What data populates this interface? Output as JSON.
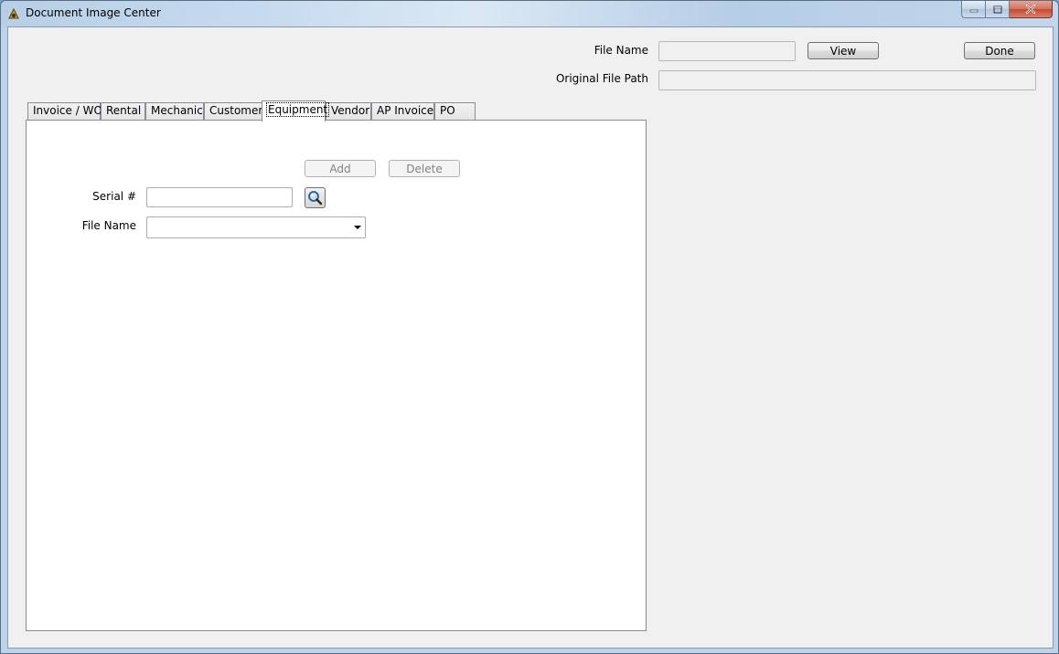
{
  "window": {
    "title": "Document Image Center"
  },
  "header": {
    "file_name_label": "File Name",
    "file_name_value": "",
    "original_path_label": "Original File Path",
    "original_path_value": "",
    "view_label": "View",
    "done_label": "Done"
  },
  "tabs": [
    {
      "label": "Invoice / WO"
    },
    {
      "label": "Rental"
    },
    {
      "label": "Mechanic"
    },
    {
      "label": "Customer"
    },
    {
      "label": "Equipment",
      "active": true
    },
    {
      "label": "Vendor"
    },
    {
      "label": "AP Invoice"
    },
    {
      "label": "PO"
    }
  ],
  "panel": {
    "add_label": "Add",
    "delete_label": "Delete",
    "serial_label": "Serial #",
    "serial_value": "",
    "file_name_label": "File Name",
    "file_name_selected": ""
  },
  "icons": {
    "app": "app-icon",
    "search": "magnifier-search-icon",
    "dropdown": "chevron-down-icon"
  },
  "colors": {
    "client_bg": "#f0f0f0",
    "panel_bg": "#ffffff",
    "close_button": "#c5492f"
  }
}
